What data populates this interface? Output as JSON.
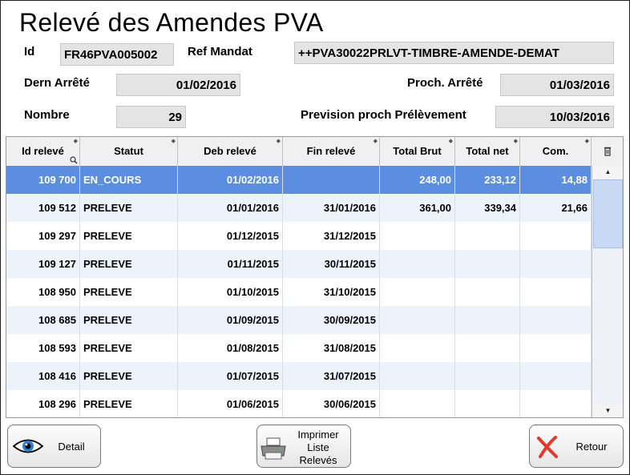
{
  "window": {
    "title": "Relevé des Amendes PVA"
  },
  "header": {
    "id_label": "Id",
    "id_value": "FR46PVA005002",
    "ref_label": "Ref Mandat",
    "ref_value": "++PVA30022PRLVT-TIMBRE-AMENDE-DEMAT",
    "dern_label": "Dern Arrêté",
    "dern_value": "01/02/2016",
    "proch_label": "Proch. Arrêté",
    "proch_value": "01/03/2016",
    "nombre_label": "Nombre",
    "nombre_value": "29",
    "prev_label": "Prevision proch Prélèvement",
    "prev_value": "10/03/2016"
  },
  "table": {
    "columns": [
      "Id relevé",
      "Statut",
      "Deb relevé",
      "Fin relevé",
      "Total Brut",
      "Total net",
      "Com."
    ],
    "rows": [
      {
        "id": "109 700",
        "statut": "EN_COURS",
        "deb": "01/02/2016",
        "fin": "",
        "brut": "248,00",
        "net": "233,12",
        "com": "14,88"
      },
      {
        "id": "109 512",
        "statut": "PRELEVE",
        "deb": "01/01/2016",
        "fin": "31/01/2016",
        "brut": "361,00",
        "net": "339,34",
        "com": "21,66"
      },
      {
        "id": "109 297",
        "statut": "PRELEVE",
        "deb": "01/12/2015",
        "fin": "31/12/2015",
        "brut": "",
        "net": "",
        "com": ""
      },
      {
        "id": "109 127",
        "statut": "PRELEVE",
        "deb": "01/11/2015",
        "fin": "30/11/2015",
        "brut": "",
        "net": "",
        "com": ""
      },
      {
        "id": "108 950",
        "statut": "PRELEVE",
        "deb": "01/10/2015",
        "fin": "31/10/2015",
        "brut": "",
        "net": "",
        "com": ""
      },
      {
        "id": "108 685",
        "statut": "PRELEVE",
        "deb": "01/09/2015",
        "fin": "30/09/2015",
        "brut": "",
        "net": "",
        "com": ""
      },
      {
        "id": "108 593",
        "statut": "PRELEVE",
        "deb": "01/08/2015",
        "fin": "31/08/2015",
        "brut": "",
        "net": "",
        "com": ""
      },
      {
        "id": "108 416",
        "statut": "PRELEVE",
        "deb": "01/07/2015",
        "fin": "31/07/2015",
        "brut": "",
        "net": "",
        "com": ""
      },
      {
        "id": "108 296",
        "statut": "PRELEVE",
        "deb": "01/06/2015",
        "fin": "30/06/2015",
        "brut": "",
        "net": "",
        "com": ""
      }
    ]
  },
  "buttons": {
    "detail": "Detail",
    "imprimer_line1": "Imprimer",
    "imprimer_line2": "Liste",
    "imprimer_line3": "Relevés",
    "retour": "Retour"
  },
  "icons": {
    "detail": "eye-icon",
    "imprimer": "printer-icon",
    "retour": "red-x-icon",
    "column_menu": "column-settings-icon",
    "sort": "sort-arrows-icon",
    "search": "magnifier-icon"
  },
  "colors": {
    "selected_row": "#5b8de0",
    "alt_row": "#edf3fb",
    "field_bg": "#e4e4e4",
    "retour_x": "#e03a2a"
  }
}
